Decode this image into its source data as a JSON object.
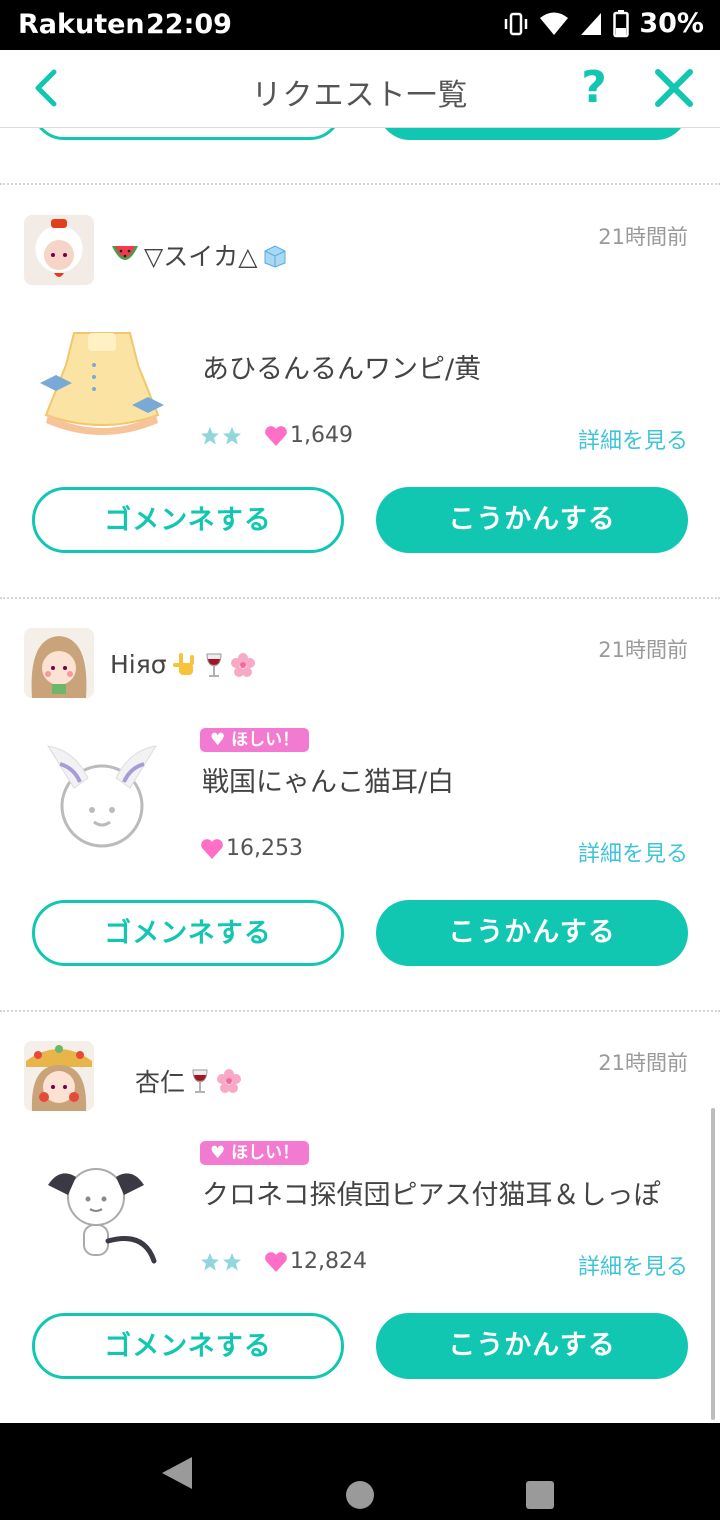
{
  "status_bar": {
    "carrier": "Rakuten",
    "time": "22:09",
    "battery": "30%"
  },
  "header": {
    "title": "リクエスト一覧",
    "help_label": "?"
  },
  "colors": {
    "accent": "#12c7b2",
    "link": "#3fc4d8",
    "wish_badge": "#f27ad0",
    "heart": "#ff6fc7"
  },
  "requests": [
    {
      "username": "▽スイカ△",
      "username_icons": [
        "watermelon-icon",
        "ice-cube-icon"
      ],
      "time": "21時間前",
      "wish_badge": "",
      "item_name": "あひるんるんワンピ/黄",
      "rarity_stars": 2,
      "likes": "1,649",
      "detail_label": "詳細を見る",
      "decline_label": "ゴメンネする",
      "accept_label": "こうかんする"
    },
    {
      "username": "Hiяσ",
      "username_icons": [
        "rock-hand-icon",
        "wine-glass-icon",
        "cherry-blossom-icon"
      ],
      "time": "21時間前",
      "wish_badge": "ほしい！",
      "item_name": "戦国にゃんこ猫耳/白",
      "rarity_stars": 0,
      "likes": "16,253",
      "detail_label": "詳細を見る",
      "decline_label": "ゴメンネする",
      "accept_label": "こうかんする"
    },
    {
      "username": "杏仁",
      "username_icons": [
        "wine-glass-icon",
        "cherry-blossom-icon"
      ],
      "time": "21時間前",
      "wish_badge": "ほしい！",
      "item_name": "クロネコ探偵団ピアス付猫耳＆しっぽ",
      "rarity_stars": 2,
      "likes": "12,824",
      "detail_label": "詳細を見る",
      "decline_label": "ゴメンネする",
      "accept_label": "こうかんする"
    }
  ]
}
